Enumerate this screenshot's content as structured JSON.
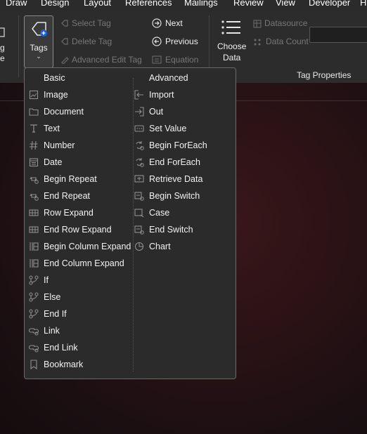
{
  "menubar": {
    "items": [
      "Draw",
      "Design",
      "Layout",
      "References",
      "Mailings",
      "Review",
      "View",
      "Developer",
      "H"
    ]
  },
  "ribbon": {
    "left_partial": [
      "g",
      "e"
    ],
    "tags_label": "Tags",
    "caret": "⌄",
    "select_tag": "Select Tag",
    "delete_tag": "Delete Tag",
    "advanced_edit_tag": "Advanced Edit Tag",
    "next": "Next",
    "previous": "Previous",
    "equation": "Equation",
    "choose_data_line1": "Choose",
    "choose_data_line2": "Data",
    "datasource": "Datasource",
    "data_count": "Data Count",
    "group_tag_properties": "Tag Properties"
  },
  "dropdown": {
    "basic_header": "Basic",
    "advanced_header": "Advanced",
    "basic_items": [
      {
        "label": "Image",
        "icon": "image-icon"
      },
      {
        "label": "Document",
        "icon": "folder-icon"
      },
      {
        "label": "Text",
        "icon": "text-icon"
      },
      {
        "label": "Number",
        "icon": "hash-icon"
      },
      {
        "label": "Date",
        "icon": "calendar-icon"
      },
      {
        "label": "Begin Repeat",
        "icon": "repeat-icon"
      },
      {
        "label": "End Repeat",
        "icon": "repeat-icon"
      },
      {
        "label": "Row Expand",
        "icon": "row-icon"
      },
      {
        "label": "End Row Expand",
        "icon": "row-icon"
      },
      {
        "label": "Begin Column Expand",
        "icon": "column-icon"
      },
      {
        "label": "End Column Expand",
        "icon": "column-icon"
      },
      {
        "label": "If",
        "icon": "branch-icon"
      },
      {
        "label": "Else",
        "icon": "branch-icon"
      },
      {
        "label": "End If",
        "icon": "branch-icon"
      },
      {
        "label": "Link",
        "icon": "link-icon"
      },
      {
        "label": "End Link",
        "icon": "link-icon"
      },
      {
        "label": "Bookmark",
        "icon": "bookmark-icon"
      }
    ],
    "advanced_items": [
      {
        "label": "Import",
        "icon": "import-icon"
      },
      {
        "label": "Out",
        "icon": "out-icon"
      },
      {
        "label": "Set Value",
        "icon": "set-value-icon"
      },
      {
        "label": "Begin ForEach",
        "icon": "foreach-icon"
      },
      {
        "label": "End ForEach",
        "icon": "foreach-icon"
      },
      {
        "label": "Retrieve Data",
        "icon": "retrieve-icon"
      },
      {
        "label": "Begin Switch",
        "icon": "switch-icon"
      },
      {
        "label": "Case",
        "icon": "case-icon"
      },
      {
        "label": "End Switch",
        "icon": "switch-icon"
      },
      {
        "label": "Chart",
        "icon": "chart-icon"
      }
    ]
  }
}
